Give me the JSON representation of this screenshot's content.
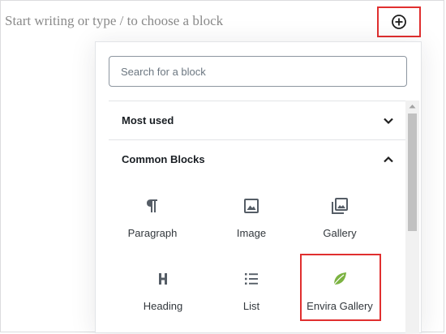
{
  "editor": {
    "placeholder": "Start writing or type / to choose a block",
    "inserter_toggle_icon": "plus-circle-icon"
  },
  "inserter": {
    "search": {
      "placeholder": "Search for a block",
      "value": ""
    },
    "sections": [
      {
        "title": "Most used",
        "expanded": false,
        "icon": "chevron-down-icon"
      },
      {
        "title": "Common Blocks",
        "expanded": true,
        "icon": "chevron-up-icon"
      }
    ],
    "blocks": [
      {
        "label": "Paragraph",
        "icon": "paragraph-icon"
      },
      {
        "label": "Image",
        "icon": "image-icon"
      },
      {
        "label": "Gallery",
        "icon": "gallery-icon"
      },
      {
        "label": "Heading",
        "icon": "heading-icon"
      },
      {
        "label": "List",
        "icon": "list-icon"
      },
      {
        "label": "Envira Gallery",
        "icon": "leaf-icon"
      }
    ]
  },
  "colors": {
    "highlight": "#e02f2f",
    "envira_leaf": "#7cb342",
    "icon": "#555d66"
  }
}
